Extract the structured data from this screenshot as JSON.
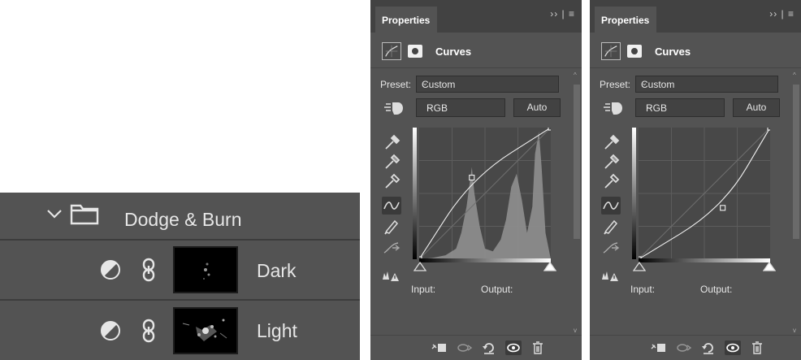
{
  "layers": {
    "group": {
      "name": "Dodge & Burn"
    },
    "children": [
      {
        "name": "Dark"
      },
      {
        "name": "Light"
      }
    ]
  },
  "panels": [
    {
      "tab": "Properties",
      "title": "Curves",
      "preset_label": "Preset:",
      "preset_value": "Custom",
      "channel_value": "RGB",
      "auto_label": "Auto",
      "input_label": "Input:",
      "output_label": "Output:",
      "curve_points": [
        [
          0,
          0
        ],
        [
          40,
          62
        ],
        [
          100,
          100
        ]
      ]
    },
    {
      "tab": "Properties",
      "title": "Curves",
      "preset_label": "Preset:",
      "preset_value": "Custom",
      "channel_value": "RGB",
      "auto_label": "Auto",
      "input_label": "Input:",
      "output_label": "Output:",
      "curve_points": [
        [
          0,
          0
        ],
        [
          64,
          39
        ],
        [
          100,
          100
        ]
      ]
    }
  ],
  "colors": {
    "panel_bg": "#535353",
    "panel_dark": "#424242",
    "text": "#e6e6e6"
  }
}
